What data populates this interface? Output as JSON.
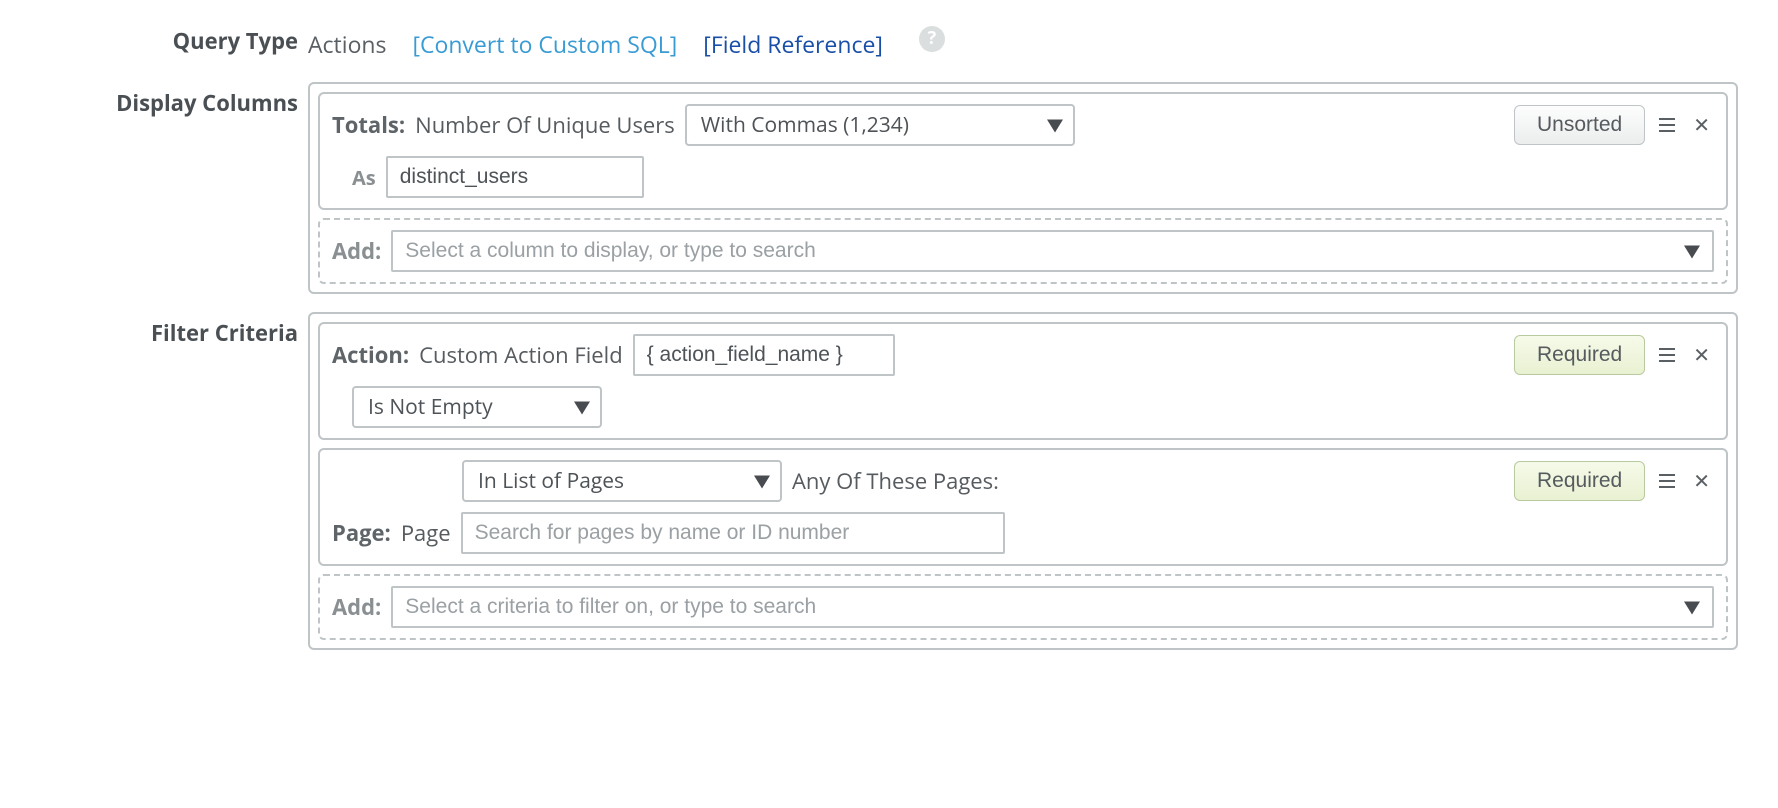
{
  "query_type": {
    "label": "Query Type",
    "value": "Actions",
    "convert_link": "[Convert to Custom SQL]",
    "field_ref_link": "[Field Reference]",
    "help_glyph": "?"
  },
  "display_columns": {
    "label": "Display Columns",
    "column": {
      "totals_label": "Totals:",
      "metric": "Number Of Unique Users",
      "format_selected": "With Commas (1,234)",
      "sort_button": "Unsorted",
      "as_label": "As",
      "alias_value": "distinct_users"
    },
    "add": {
      "label": "Add:",
      "placeholder": "Select a column to display, or type to search"
    }
  },
  "filter_criteria": {
    "label": "Filter Criteria",
    "required_label": "Required",
    "action_filter": {
      "action_label": "Action:",
      "field_text": "Custom Action Field",
      "token_value": "{ action_field_name }",
      "operator_selected": "Is Not Empty"
    },
    "page_filter": {
      "mode_selected": "In List of Pages",
      "any_label": "Any Of These Pages:",
      "page_label": "Page:",
      "page_value": "Page",
      "search_placeholder": "Search for pages by name or ID number"
    },
    "add": {
      "label": "Add:",
      "placeholder": "Select a criteria to filter on, or type to search"
    }
  }
}
